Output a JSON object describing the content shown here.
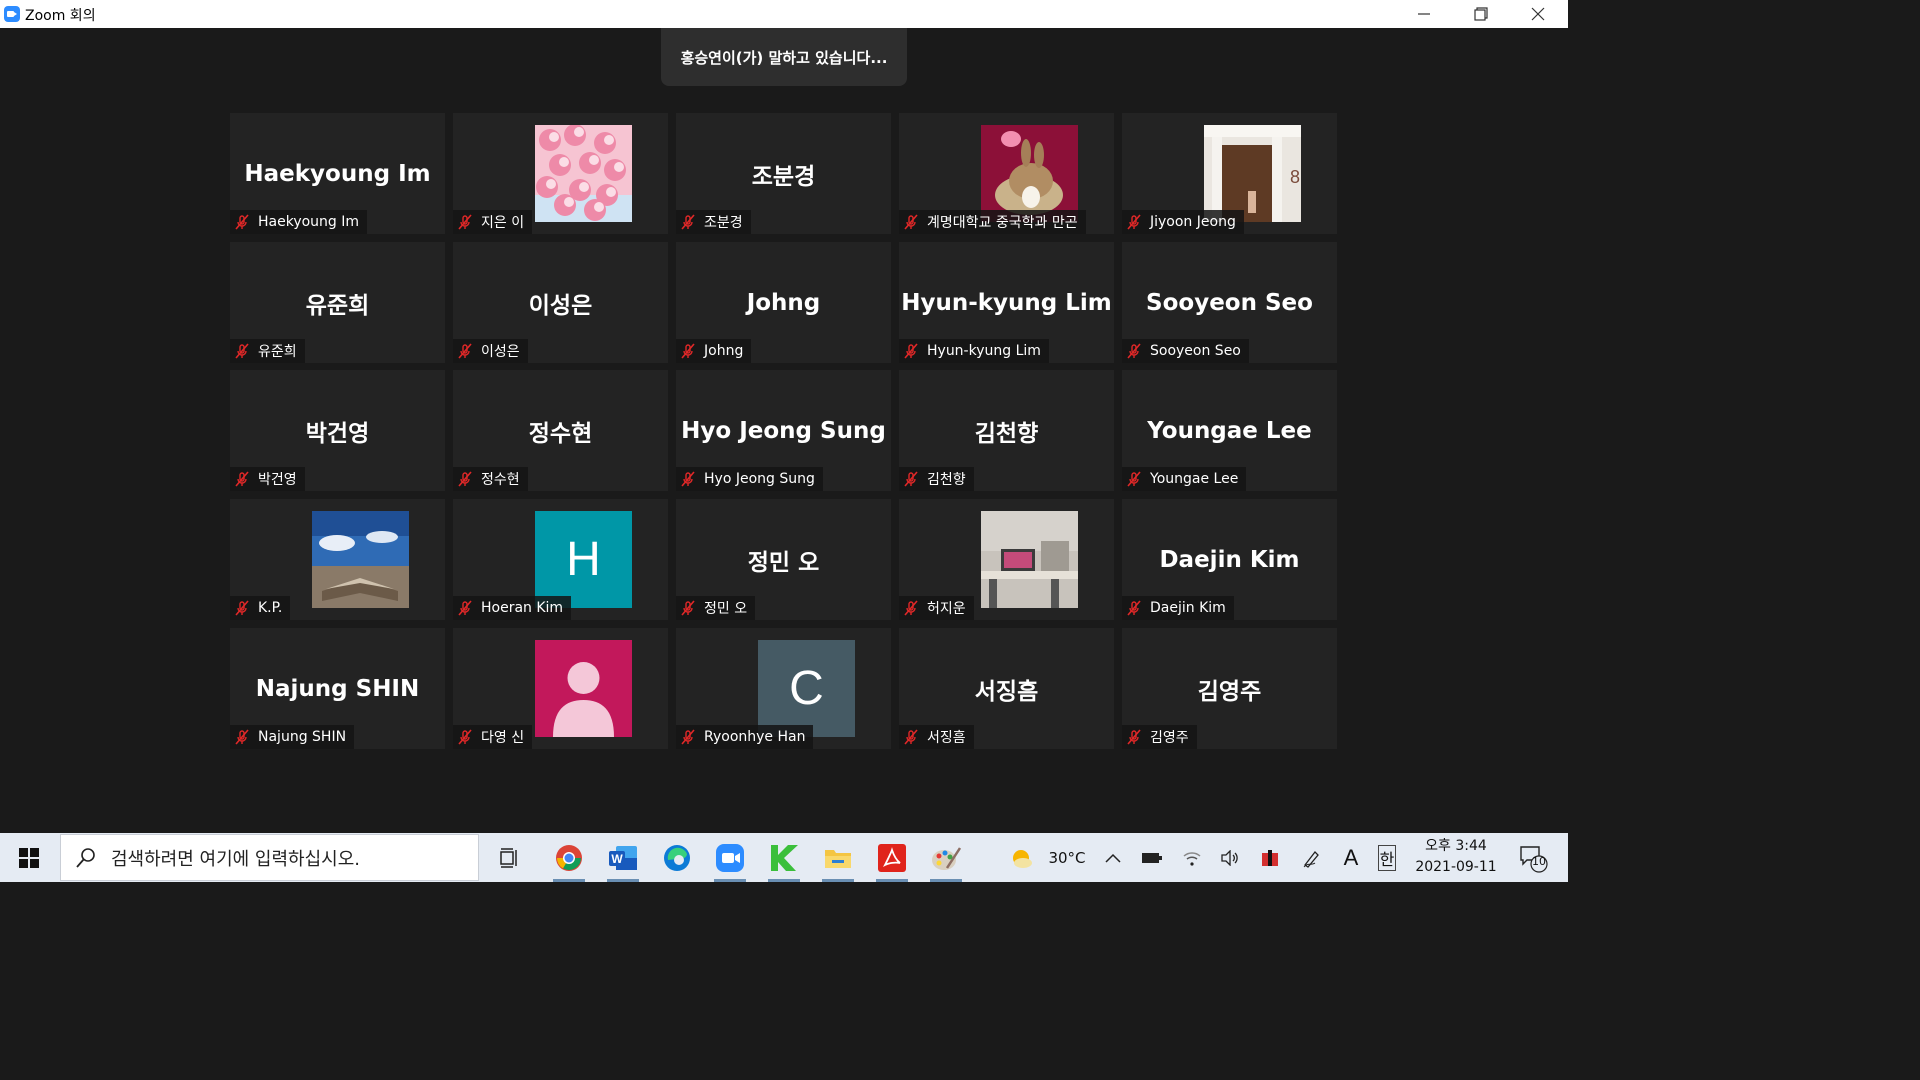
{
  "window": {
    "title": "Zoom 회의",
    "controls": [
      "minimize",
      "restore",
      "close"
    ]
  },
  "speaking_banner": "홍승연이(가) 말하고 있습니다...",
  "participants": [
    {
      "display": "Haekyoung Im",
      "label": "Haekyoung Im",
      "type": "name",
      "muted": true
    },
    {
      "display": "",
      "label": "지은 이",
      "type": "photo-cherry-blossom",
      "muted": true
    },
    {
      "display": "조분경",
      "label": "조분경",
      "type": "name",
      "muted": true
    },
    {
      "display": "",
      "label": "계명대학교 중국학과 만곤",
      "type": "photo-rabbit",
      "muted": true
    },
    {
      "display": "",
      "label": "Jiyoon Jeong",
      "type": "photo-room",
      "muted": true
    },
    {
      "display": "유준희",
      "label": "유준희",
      "type": "name",
      "muted": true
    },
    {
      "display": "이성은",
      "label": "이성은",
      "type": "name",
      "muted": true
    },
    {
      "display": "Johng",
      "label": "Johng",
      "type": "name",
      "muted": true
    },
    {
      "display": "Hyun-kyung Lim",
      "label": "Hyun-kyung Lim",
      "type": "name",
      "muted": true
    },
    {
      "display": "Sooyeon Seo",
      "label": "Sooyeon Seo",
      "type": "name",
      "muted": true
    },
    {
      "display": "박건영",
      "label": "박건영",
      "type": "name",
      "muted": true
    },
    {
      "display": "정수현",
      "label": "정수현",
      "type": "name",
      "muted": true
    },
    {
      "display": "Hyo Jeong Sung",
      "label": "Hyo Jeong Sung",
      "type": "name",
      "muted": true
    },
    {
      "display": "김천향",
      "label": "김천향",
      "type": "name",
      "muted": true
    },
    {
      "display": "Youngae Lee",
      "label": "Youngae Lee",
      "type": "name",
      "muted": true
    },
    {
      "display": "",
      "label": "K.P.",
      "type": "photo-book-landscape",
      "muted": true
    },
    {
      "display": "H",
      "label": "Hoeran Kim",
      "type": "letter",
      "color": "#0097a7",
      "muted": true
    },
    {
      "display": "정민 오",
      "label": "정민 오",
      "type": "name",
      "muted": true
    },
    {
      "display": "",
      "label": "허지운",
      "type": "photo-desk",
      "muted": true
    },
    {
      "display": "Daejin Kim",
      "label": "Daejin Kim",
      "type": "name",
      "muted": true
    },
    {
      "display": "Najung SHIN",
      "label": "Najung SHIN",
      "type": "name",
      "muted": true
    },
    {
      "display": "",
      "label": "다영 신",
      "type": "person-icon",
      "color": "#c2185b",
      "muted": true
    },
    {
      "display": "C",
      "label": "Ryoonhye Han",
      "type": "letter",
      "color": "#455a64",
      "muted": true
    },
    {
      "display": "서징흠",
      "label": "서징흠",
      "type": "name",
      "muted": true
    },
    {
      "display": "김영주",
      "label": "김영주",
      "type": "name",
      "muted": true
    }
  ],
  "taskbar": {
    "search_placeholder": "검색하려면 여기에 입력하십시오.",
    "apps": [
      "start-icon",
      "task-view-icon",
      "chrome-icon",
      "word-icon",
      "edge-icon",
      "zoom-icon",
      "kakaotalk-icon",
      "file-explorer-icon",
      "acrobat-icon",
      "paint-icon"
    ],
    "weather": "30°C",
    "ime_letter": "A",
    "ime_lang": "한",
    "clock_time": "오후 3:44",
    "clock_date": "2021-09-11",
    "notification_count": "10"
  },
  "colors": {
    "mute_red": "#e02828",
    "tile_bg": "#232323",
    "zoom_blue": "#2d8cff"
  }
}
